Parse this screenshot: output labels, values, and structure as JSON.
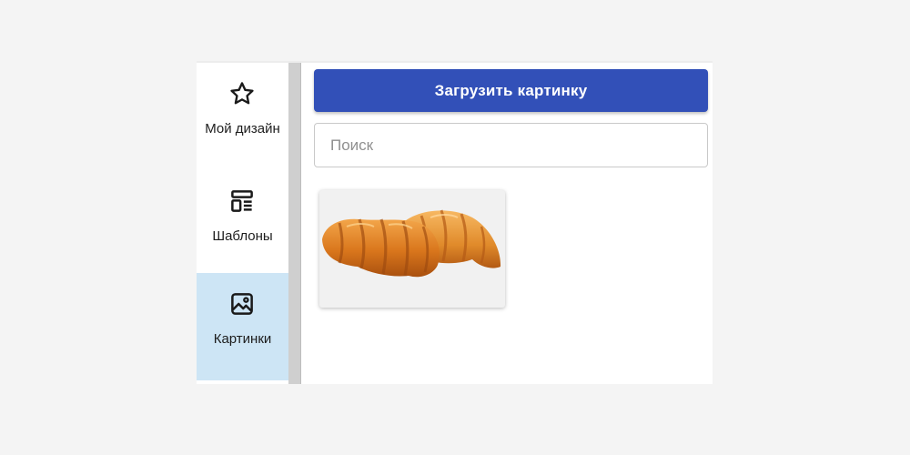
{
  "sidebar": {
    "items": [
      {
        "label": "Мой дизайн",
        "icon": "star-icon"
      },
      {
        "label": "Шаблоны",
        "icon": "template-icon"
      },
      {
        "label": "Картинки",
        "icon": "image-icon",
        "active": true
      }
    ],
    "active_color": "#cde5f5"
  },
  "content": {
    "upload_button_label": "Загрузить картинку",
    "upload_button_color": "#3250b8",
    "search": {
      "placeholder": "Поиск",
      "value": ""
    },
    "images": [
      {
        "subject": "croissants"
      }
    ]
  }
}
